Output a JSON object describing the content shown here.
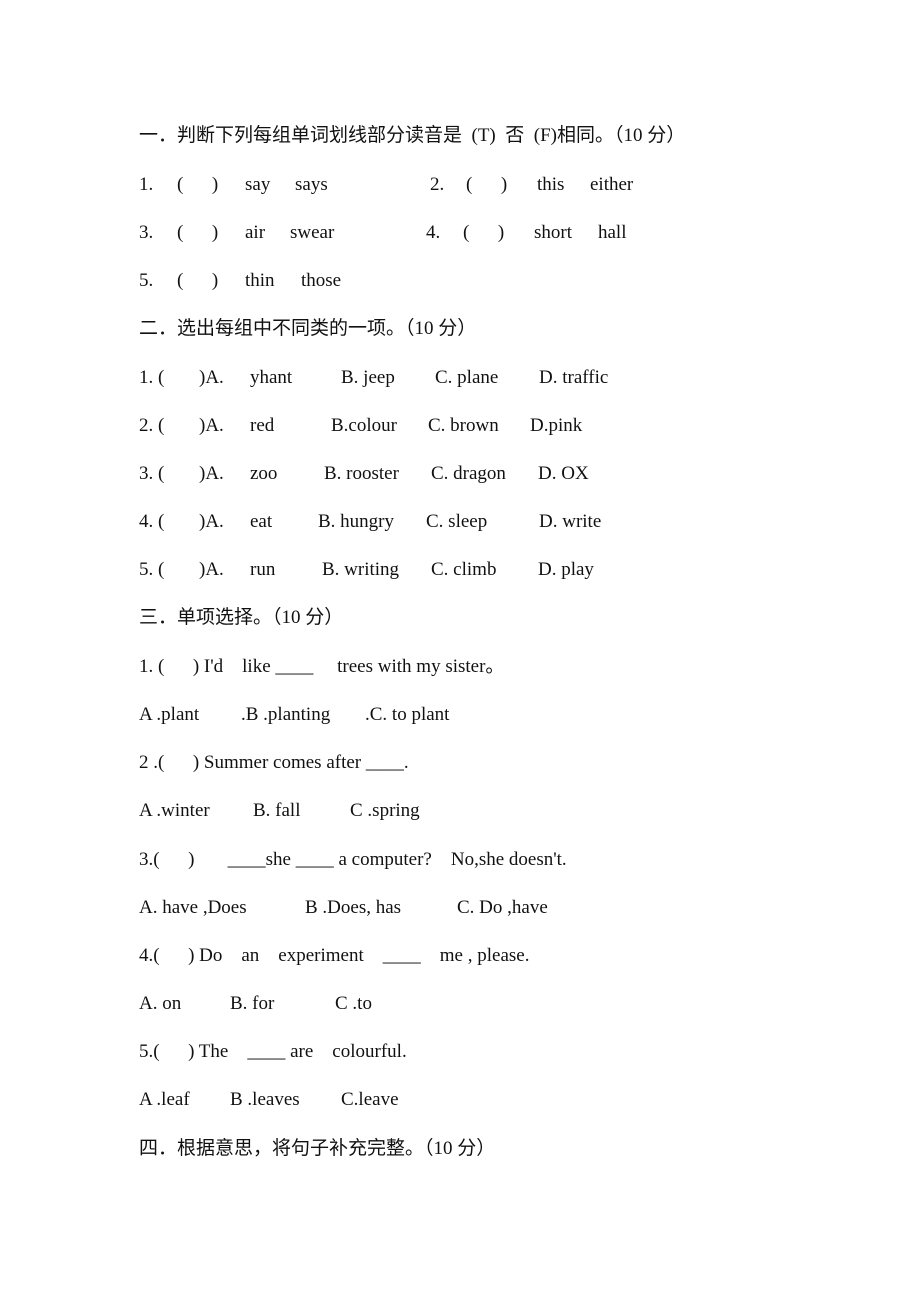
{
  "sections": [
    {
      "heading": "一．判断下列每组单词划线部分读音是  (T)  否  (F)相同。（10 分）",
      "items": [
        {
          "num": "1.",
          "paren": "(      )",
          "words": [
            "say",
            "says"
          ]
        },
        {
          "num": "2.",
          "paren": "(      )",
          "words": [
            "this",
            "either"
          ]
        },
        {
          "num": "3.",
          "paren": "(      )",
          "words": [
            "air",
            "swear"
          ]
        },
        {
          "num": "4.",
          "paren": "(      )",
          "words": [
            "short",
            "hall"
          ]
        },
        {
          "num": "5.",
          "paren": "(      )",
          "words": [
            "thin",
            "those"
          ]
        }
      ]
    },
    {
      "heading": "二．选出每组中不同类的一项。（10 分）",
      "items": [
        {
          "num": "1. (",
          "close": ")A.",
          "options": [
            "yhant",
            "B. jeep",
            "C. plane",
            "D. traffic"
          ]
        },
        {
          "num": "2. (",
          "close": ")A.",
          "options": [
            "red",
            "B.colour",
            "C. brown",
            "D.pink"
          ]
        },
        {
          "num": "3. (",
          "close": ")A.",
          "options": [
            "zoo",
            "B. rooster",
            "C. dragon",
            "D. OX"
          ]
        },
        {
          "num": "4. (",
          "close": ")A.",
          "options": [
            "eat",
            "B. hungry",
            "C. sleep",
            "D. write"
          ]
        },
        {
          "num": "5. (",
          "close": ")A.",
          "options": [
            "run",
            "B. writing",
            "C. climb",
            "D. play"
          ]
        }
      ]
    },
    {
      "heading": "三．单项选择。（10 分）",
      "items": [
        {
          "question": "1. (      ) I'd    like ____     trees with my sister。",
          "options": [
            "A .plant",
            ".B .planting",
            ".C. to plant"
          ]
        },
        {
          "question": "2 .(      ) Summer comes after ____.",
          "options": [
            "A .winter",
            "B. fall",
            "C .spring"
          ]
        },
        {
          "question": "3.(      )       ____she ____ a computer?    No,she doesn't.",
          "options": [
            "A. have ,Does",
            "B .Does, has",
            "C. Do ,have"
          ]
        },
        {
          "question": "4.(      ) Do    an    experiment    ____    me , please.",
          "options": [
            "A. on",
            "B. for",
            "C .to"
          ]
        },
        {
          "question": "5.(      ) The    ____ are    colourful.",
          "options": [
            "A .leaf",
            "B .leaves",
            "C.leave"
          ]
        }
      ]
    },
    {
      "heading": "四．根据意思，将句子补充完整。（10 分）"
    }
  ]
}
